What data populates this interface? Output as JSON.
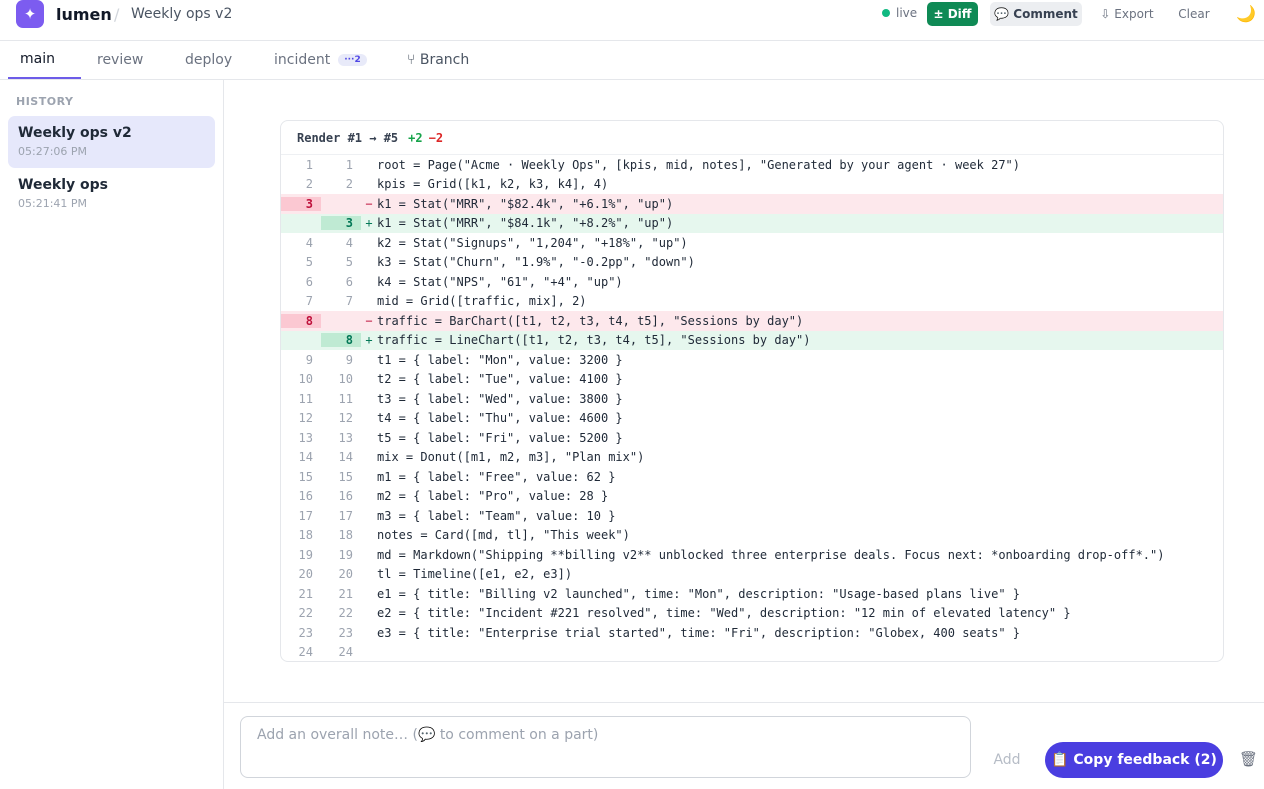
{
  "header": {
    "logo_glyph": "✦",
    "brand": "lumen",
    "separator": "/",
    "doc_title": "Weekly ops v2",
    "live_label": "live",
    "diff_label": "± Diff",
    "comment_label": "💬 Comment",
    "export_label": "⇩ Export",
    "clear_label": "Clear",
    "theme_icon": "🌙"
  },
  "tabs": [
    {
      "label": "main",
      "active": true
    },
    {
      "label": "review"
    },
    {
      "label": "deploy"
    },
    {
      "label": "incident",
      "badge": "···2"
    },
    {
      "label": "⑂ Branch"
    }
  ],
  "sidebar": {
    "heading": "HISTORY",
    "items": [
      {
        "name": "Weekly ops v2",
        "time": "05:27:06 PM",
        "selected": true
      },
      {
        "name": "Weekly ops",
        "time": "05:21:41 PM"
      }
    ]
  },
  "diff": {
    "title": "Render #1 → #5",
    "added": "+2",
    "removed": "−2",
    "lines": [
      {
        "type": "ctx",
        "old": "1",
        "new": "1",
        "text": "root = Page(\"Acme · Weekly Ops\", [kpis, mid, notes], \"Generated by your agent · week 27\")"
      },
      {
        "type": "ctx",
        "old": "2",
        "new": "2",
        "text": "kpis = Grid([k1, k2, k3, k4], 4)"
      },
      {
        "type": "del",
        "old": "3",
        "new": "",
        "text": "k1 = Stat(\"MRR\", \"$82.4k\", \"+6.1%\", \"up\")"
      },
      {
        "type": "add",
        "old": "",
        "new": "3",
        "text": "k1 = Stat(\"MRR\", \"$84.1k\", \"+8.2%\", \"up\")"
      },
      {
        "type": "ctx",
        "old": "4",
        "new": "4",
        "text": "k2 = Stat(\"Signups\", \"1,204\", \"+18%\", \"up\")"
      },
      {
        "type": "ctx",
        "old": "5",
        "new": "5",
        "text": "k3 = Stat(\"Churn\", \"1.9%\", \"-0.2pp\", \"down\")"
      },
      {
        "type": "ctx",
        "old": "6",
        "new": "6",
        "text": "k4 = Stat(\"NPS\", \"61\", \"+4\", \"up\")"
      },
      {
        "type": "ctx",
        "old": "7",
        "new": "7",
        "text": "mid = Grid([traffic, mix], 2)"
      },
      {
        "type": "del",
        "old": "8",
        "new": "",
        "text": "traffic = BarChart([t1, t2, t3, t4, t5], \"Sessions by day\")"
      },
      {
        "type": "add",
        "old": "",
        "new": "8",
        "text": "traffic = LineChart([t1, t2, t3, t4, t5], \"Sessions by day\")"
      },
      {
        "type": "ctx",
        "old": "9",
        "new": "9",
        "text": "t1 = { label: \"Mon\", value: 3200 }"
      },
      {
        "type": "ctx",
        "old": "10",
        "new": "10",
        "text": "t2 = { label: \"Tue\", value: 4100 }"
      },
      {
        "type": "ctx",
        "old": "11",
        "new": "11",
        "text": "t3 = { label: \"Wed\", value: 3800 }"
      },
      {
        "type": "ctx",
        "old": "12",
        "new": "12",
        "text": "t4 = { label: \"Thu\", value: 4600 }"
      },
      {
        "type": "ctx",
        "old": "13",
        "new": "13",
        "text": "t5 = { label: \"Fri\", value: 5200 }"
      },
      {
        "type": "ctx",
        "old": "14",
        "new": "14",
        "text": "mix = Donut([m1, m2, m3], \"Plan mix\")"
      },
      {
        "type": "ctx",
        "old": "15",
        "new": "15",
        "text": "m1 = { label: \"Free\", value: 62 }"
      },
      {
        "type": "ctx",
        "old": "16",
        "new": "16",
        "text": "m2 = { label: \"Pro\", value: 28 }"
      },
      {
        "type": "ctx",
        "old": "17",
        "new": "17",
        "text": "m3 = { label: \"Team\", value: 10 }"
      },
      {
        "type": "ctx",
        "old": "18",
        "new": "18",
        "text": "notes = Card([md, tl], \"This week\")"
      },
      {
        "type": "ctx",
        "old": "19",
        "new": "19",
        "text": "md = Markdown(\"Shipping **billing v2** unblocked three enterprise deals. Focus next: *onboarding drop-off*.\")"
      },
      {
        "type": "ctx",
        "old": "20",
        "new": "20",
        "text": "tl = Timeline([e1, e2, e3])"
      },
      {
        "type": "ctx",
        "old": "21",
        "new": "21",
        "text": "e1 = { title: \"Billing v2 launched\", time: \"Mon\", description: \"Usage-based plans live\" }"
      },
      {
        "type": "ctx",
        "old": "22",
        "new": "22",
        "text": "e2 = { title: \"Incident #221 resolved\", time: \"Wed\", description: \"12 min of elevated latency\" }"
      },
      {
        "type": "ctx",
        "old": "23",
        "new": "23",
        "text": "e3 = { title: \"Enterprise trial started\", time: \"Fri\", description: \"Globex, 400 seats\" }"
      },
      {
        "type": "ctx",
        "old": "24",
        "new": "24",
        "text": ""
      }
    ]
  },
  "footer": {
    "note_placeholder": "Add an overall note… (💬 to comment on a part)",
    "add_label": "Add",
    "copy_label": "📋 Copy feedback (2)",
    "trash_icon": "🗑"
  }
}
